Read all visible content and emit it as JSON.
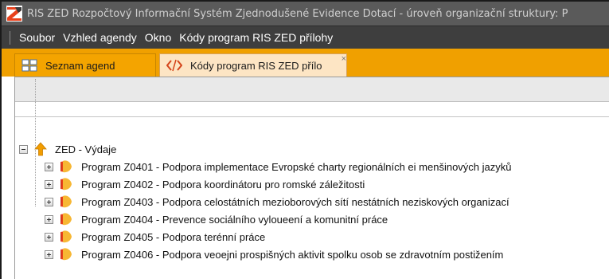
{
  "window": {
    "title": "RIS ZED Rozpočtový Informační Systém Zjednodušené Evidence Dotací - úroveň organizační struktury: P",
    "logo_icon": "app-logo-icon"
  },
  "menu": {
    "items": [
      {
        "label": "Soubor"
      },
      {
        "label": "Vzhled agendy"
      },
      {
        "label": "Okno"
      },
      {
        "label": "Kódy program RIS ZED přílohy"
      }
    ]
  },
  "tabs": [
    {
      "label": "Seznam agend",
      "icon": "grid-icon",
      "active": true
    },
    {
      "label": "Kódy program RIS ZED přílo",
      "icon": "code-icon",
      "active": false,
      "close_glyph": "×"
    }
  ],
  "tree": {
    "root": {
      "label": "ZED - Výdaje",
      "icon": "arrow-up-icon",
      "expanded": true
    },
    "children": [
      {
        "label": "Program Z0401 - Podpora implementace Evropské charty regionálních ei menšinových jazyků",
        "icon": "program-icon"
      },
      {
        "label": "Program Z0402 - Podpora koordinátoru pro romské záležitosti",
        "icon": "program-icon"
      },
      {
        "label": "Program Z0403 - Podpora celostátních mezioborových sítí nestátních neziskových organizací",
        "icon": "program-icon"
      },
      {
        "label": "Program Z0404 - Prevence sociálního vyloueení a komunitní práce",
        "icon": "program-icon"
      },
      {
        "label": "Program Z0405 - Podpora terénní práce",
        "icon": "program-icon"
      },
      {
        "label": "Program Z0406 - Podpora veoejni prospišných aktivit spolku osob se zdravotním postižením",
        "icon": "program-icon"
      }
    ]
  },
  "colors": {
    "titlebar": "#5a5a5a",
    "menubar": "#3e3e3e",
    "tabstrip": "#f0a000",
    "accent": "#f4a400"
  }
}
